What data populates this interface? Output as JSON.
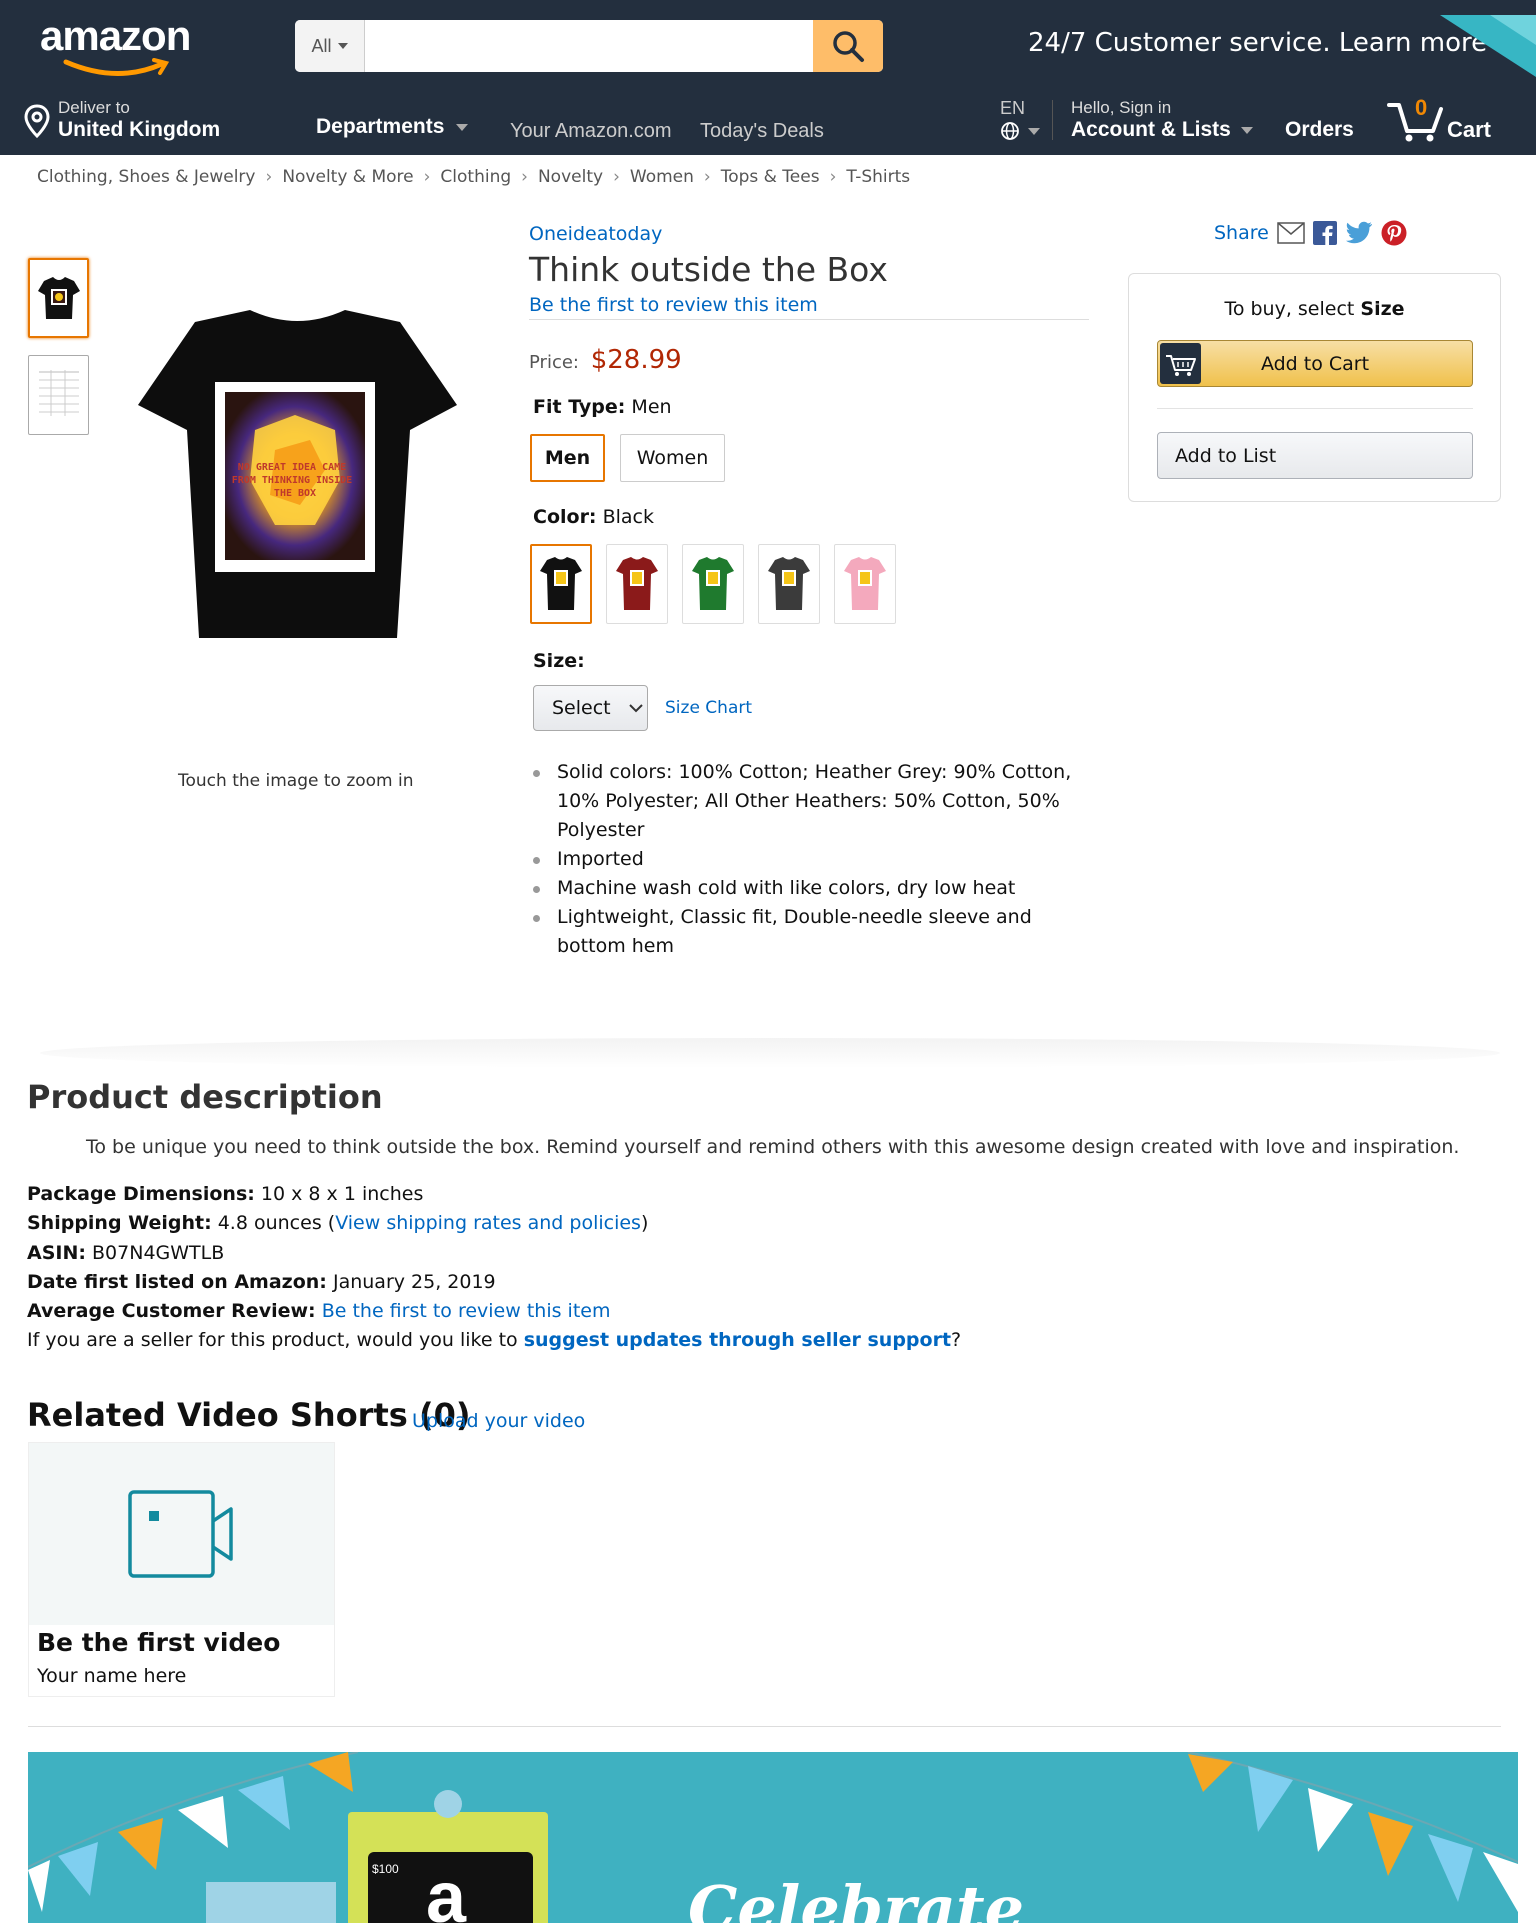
{
  "header": {
    "logo_text": "amazon",
    "search": {
      "dept_label": "All",
      "placeholder": "",
      "value": ""
    },
    "promo": "24/7 Customer service. Learn more",
    "deliver_small": "Deliver to",
    "deliver_big": "United Kingdom",
    "departments": "Departments",
    "your_amazon": "Your Amazon.com",
    "todays_deals": "Today's Deals",
    "lang": "EN",
    "account_small": "Hello, Sign in",
    "account_big": "Account & Lists",
    "orders": "Orders",
    "cart_count": "0",
    "cart_label": "Cart"
  },
  "breadcrumb": [
    "Clothing, Shoes & Jewelry",
    "Novelty & More",
    "Clothing",
    "Novelty",
    "Women",
    "Tops & Tees",
    "T-Shirts"
  ],
  "breadcrumb_sep": "›",
  "gallery": {
    "zoom_hint": "Touch the image to zoom in",
    "print_text": "NO GREAT IDEA CAME FROM THINKING INSIDE THE BOX"
  },
  "product": {
    "brand": "Oneideatoday",
    "title": "Think outside the Box",
    "review_link": "Be the first to review this item",
    "price_label": "Price:",
    "price": "$28.99",
    "fit_label": "Fit Type:",
    "fit_value": "Men",
    "fit_options": [
      "Men",
      "Women"
    ],
    "color_label": "Color:",
    "color_value": "Black",
    "swatch_colors": [
      "#111111",
      "#8b1a1a",
      "#1f7a2e",
      "#3b3b3b",
      "#f4a9bd"
    ],
    "size_label": "Size:",
    "size_select": "Select",
    "size_chart": "Size Chart",
    "bullets": [
      "Solid colors: 100% Cotton; Heather Grey: 90% Cotton, 10% Polyester; All Other Heathers: 50% Cotton, 50% Polyester",
      "Imported",
      "Machine wash cold with like colors, dry low heat",
      "Lightweight, Classic fit, Double-needle sleeve and bottom hem"
    ]
  },
  "buybox": {
    "share": "Share",
    "prompt_prefix": "To buy, select ",
    "prompt_bold": "Size",
    "add_to_cart": "Add to Cart",
    "add_to_list": "Add to List"
  },
  "description": {
    "heading": "Product description",
    "text": "To be unique you need to think outside the box. Remind yourself and remind others with this awesome design created with love and inspiration.",
    "pkg_label": "Package Dimensions:",
    "pkg_value": "10 x 8 x 1 inches",
    "ship_label": "Shipping Weight:",
    "ship_value": "4.8 ounces",
    "ship_link": "View shipping rates and policies",
    "asin_label": "ASIN:",
    "asin_value": "B07N4GWTLB",
    "date_label": "Date first listed on Amazon:",
    "date_value": "January 25, 2019",
    "review_label": "Average Customer Review:",
    "review_link": "Be the first to review this item",
    "seller_prefix": "If you are a seller for this product, would you like to ",
    "seller_link": "suggest updates through seller support",
    "seller_suffix": "?"
  },
  "videos": {
    "heading": "Related Video Shorts (0)",
    "upload": "Upload your video",
    "card_title": "Be the first video",
    "card_author": "Your name here"
  },
  "banner": {
    "text": "Celebrate"
  },
  "colors": {
    "nav_bg": "#232f3e",
    "search_btn": "#febd69",
    "link": "#0066c0",
    "price": "#b12704",
    "accent": "#e77600",
    "banner": "#3fb1c1"
  }
}
